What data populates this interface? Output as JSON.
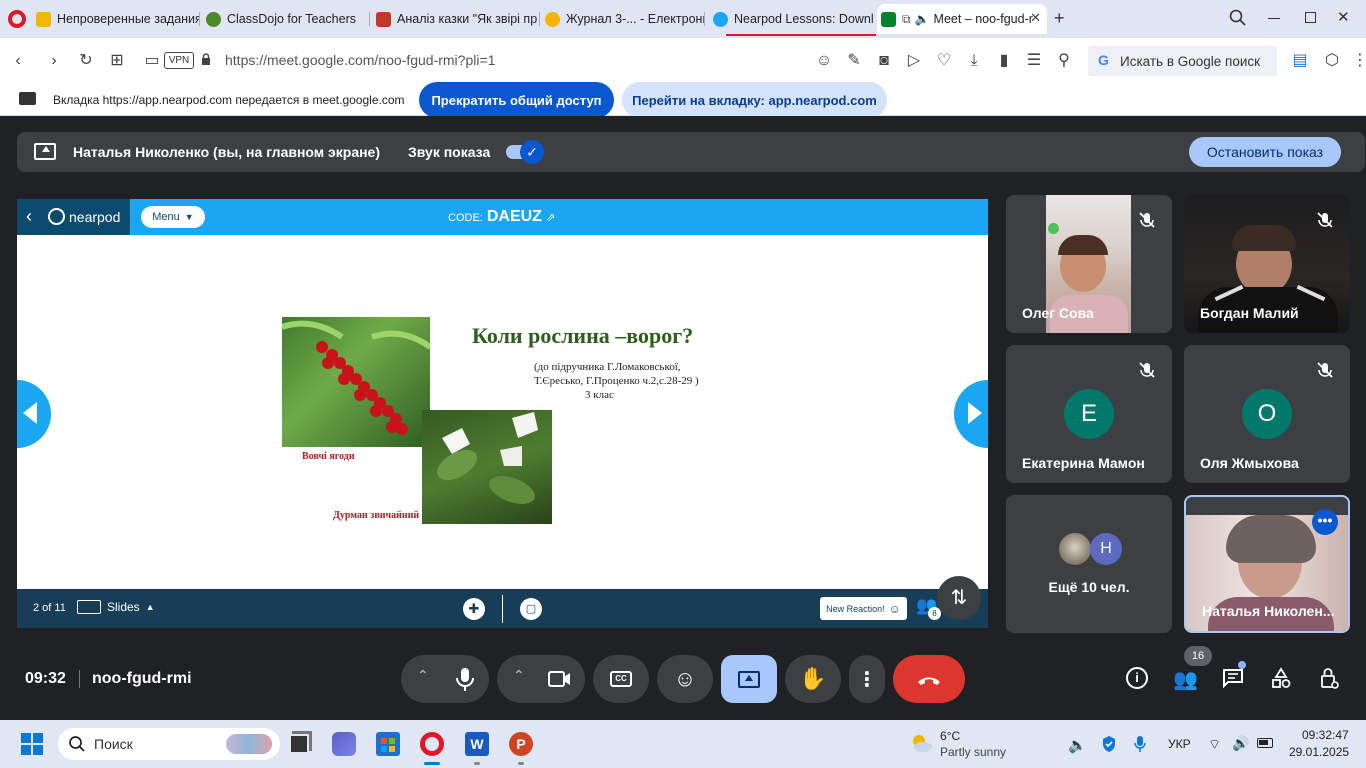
{
  "browser": {
    "tabs": [
      {
        "label": "Непроверенные задания",
        "color": "#f2b700"
      },
      {
        "label": "ClassDojo for Teachers",
        "color": "#4a8a2a"
      },
      {
        "label": "Аналіз казки \"Як звірі пр",
        "color": "#c0392b"
      },
      {
        "label": "Журнал 3-... - Електронні",
        "color": "#f5b400"
      },
      {
        "label": "Nearpod Lessons: Downlo",
        "color": "#1aa6f0"
      },
      {
        "label": "Meet – noo-fgud-r",
        "color": "#00832d"
      }
    ],
    "url": "https://meet.google.com/noo-fgud-rmi?pli=1",
    "vpn_label": "VPN",
    "search_placeholder": "Искать в Google поиск"
  },
  "share_bar": {
    "message": "Вкладка https://app.nearpod.com передается в meet.google.com",
    "stop_sharing_label": "Прекратить общий доступ",
    "switch_tab_label": "Перейти на вкладку: app.nearpod.com"
  },
  "presenting_bar": {
    "presenter": "Наталья Николенко (вы, на главном экране)",
    "sound_label": "Звук показа",
    "sound_on": true,
    "stop_label": "Остановить показ"
  },
  "nearpod": {
    "menu_label": "Menu",
    "code_label": "CODE:",
    "code": "DAEUZ",
    "slide_counter": "2 of 11",
    "slides_label": "Slides",
    "reaction_label": "New Reaction!",
    "participants_badge": "8",
    "slide": {
      "title": "Коли рослина –ворог?",
      "subtitle_lines": [
        "(до підручника Г.Ломаковської,",
        "Т.Єресько, Г.Проценко ч.2,с.28-29 )",
        "3 клас"
      ],
      "caption_1": "Вовчі ягоди",
      "caption_2": "Дурман звичайний"
    }
  },
  "participants": [
    {
      "name": "Олег Сова",
      "type": "video"
    },
    {
      "name": "Богдан Малий",
      "type": "video"
    },
    {
      "name": "Екатерина Мамон",
      "type": "avatar",
      "initial": "Е",
      "color": "#00796b"
    },
    {
      "name": "Оля Жмыхова",
      "type": "avatar",
      "initial": "О",
      "color": "#00796b"
    },
    {
      "name": "Ещё 10 чел.",
      "type": "more",
      "initial": "Н",
      "color": "#5c6bc0"
    },
    {
      "name": "Наталья Николен...",
      "type": "self"
    }
  ],
  "meeting": {
    "time": "09:32",
    "code": "noo-fgud-rmi",
    "people_count": "16"
  },
  "taskbar": {
    "search_label": "Поиск",
    "weather_temp": "6°C",
    "weather_desc": "Partly sunny",
    "lang": "УКР",
    "clock_time": "09:32:47",
    "clock_date": "29.01.2025"
  }
}
